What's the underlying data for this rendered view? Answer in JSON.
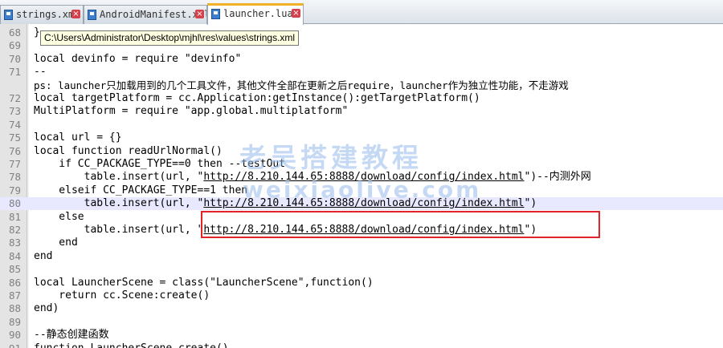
{
  "tabs": [
    {
      "label": "strings.xml",
      "close": "×",
      "active": false
    },
    {
      "label": "AndroidManifest.xml",
      "close": "×",
      "active": false
    },
    {
      "label": "launcher.luac",
      "close": "×",
      "active": true
    }
  ],
  "tooltip": "C:\\Users\\Administrator\\Desktop\\mjhl\\res\\values\\strings.xml",
  "lines": [
    {
      "n": "68",
      "code": "}"
    },
    {
      "n": "69",
      "code": ""
    },
    {
      "n": "70",
      "code": "local devinfo = require \"devinfo\""
    },
    {
      "n": "71",
      "code": "--"
    },
    {
      "n": "",
      "code": "ps: launcher只加载用到的几个工具文件，其他文件全部在更新之后require，launcher作为独立性功能，不走游戏"
    },
    {
      "n": "72",
      "code": "local targetPlatform = cc.Application:getInstance():getTargetPlatform()"
    },
    {
      "n": "73",
      "code": "MultiPlatform = require \"app.global.multiplatform\""
    },
    {
      "n": "74",
      "code": ""
    },
    {
      "n": "75",
      "code": "local url = {}"
    },
    {
      "n": "76",
      "code": "local function readUrlNormal()"
    },
    {
      "n": "77",
      "code": "    if CC_PACKAGE_TYPE==0 then --testOut"
    },
    {
      "n": "78",
      "code": "        table.insert(url, \"",
      "url": "http://8.210.144.65:8888/download/config/index.html",
      "after": "\")--内测外网"
    },
    {
      "n": "79",
      "code": "    elseif CC_PACKAGE_TYPE==1 then"
    },
    {
      "n": "80",
      "code": "        table.insert(url, \"",
      "url": "http://8.210.144.65:8888/download/config/index.html",
      "after": "\")"
    },
    {
      "n": "81",
      "code": "    else"
    },
    {
      "n": "82",
      "code": "        table.insert(url, \"",
      "url": "http://8.210.144.65:8888/download/config/index.html",
      "after": "\")"
    },
    {
      "n": "83",
      "code": "    end"
    },
    {
      "n": "84",
      "code": "end"
    },
    {
      "n": "85",
      "code": ""
    },
    {
      "n": "86",
      "code": "local LauncherScene = class(\"LauncherScene\",function()"
    },
    {
      "n": "87",
      "code": "    return cc.Scene:create()"
    },
    {
      "n": "88",
      "code": "end)"
    },
    {
      "n": "89",
      "code": ""
    },
    {
      "n": "90",
      "code": "--静态创建函数"
    },
    {
      "n": "91",
      "code": "function LauncherScene.create()"
    }
  ],
  "watermark": {
    "line1": "老吴搭建教程",
    "line2": "weixiaolive.com"
  },
  "colors": {
    "caret_line": "#e8e8ff",
    "highlight_box": "#e2232a",
    "active_tab_accent": "#f0b028"
  }
}
